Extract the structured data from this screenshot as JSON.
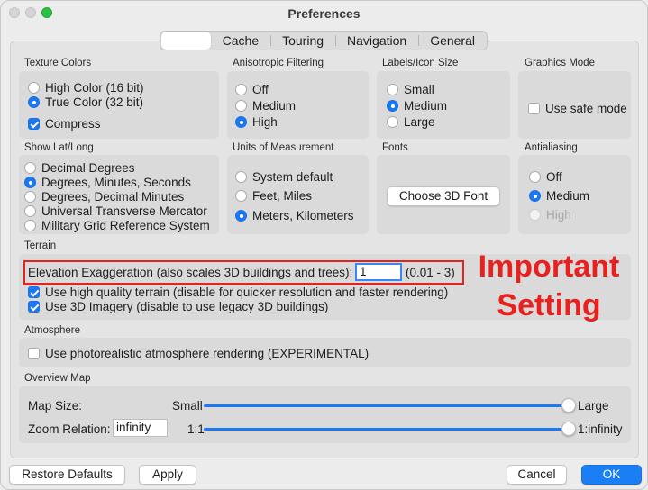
{
  "window": {
    "title": "Preferences"
  },
  "tabs": [
    {
      "label": "",
      "selected": true
    },
    {
      "label": "Cache"
    },
    {
      "label": "Touring"
    },
    {
      "label": "Navigation"
    },
    {
      "label": "General"
    }
  ],
  "texture_colors": {
    "label": "Texture Colors",
    "options": [
      "High Color (16 bit)",
      "True Color (32 bit)"
    ],
    "selected": "True Color (32 bit)",
    "compress_label": "Compress",
    "compress_checked": true
  },
  "anisotropic": {
    "label": "Anisotropic Filtering",
    "options": [
      "Off",
      "Medium",
      "High"
    ],
    "selected": "High"
  },
  "labels_icon_size": {
    "label": "Labels/Icon Size",
    "options": [
      "Small",
      "Medium",
      "Large"
    ],
    "selected": "Medium"
  },
  "graphics_mode": {
    "label": "Graphics Mode",
    "safe_mode_label": "Use safe mode",
    "safe_mode_checked": false
  },
  "show_lat_long": {
    "label": "Show Lat/Long",
    "options": [
      "Decimal Degrees",
      "Degrees, Minutes, Seconds",
      "Degrees, Decimal Minutes",
      "Universal Transverse Mercator",
      "Military Grid Reference System"
    ],
    "selected": "Degrees, Minutes, Seconds"
  },
  "units": {
    "label": "Units of Measurement",
    "options": [
      "System default",
      "Feet, Miles",
      "Meters, Kilometers"
    ],
    "selected": "Meters, Kilometers"
  },
  "fonts": {
    "label": "Fonts",
    "button_label": "Choose 3D Font"
  },
  "antialiasing": {
    "label": "Antialiasing",
    "options": [
      "Off",
      "Medium",
      "High"
    ],
    "selected": "Medium",
    "disabled": "High"
  },
  "terrain": {
    "label": "Terrain",
    "elevation_label": "Elevation Exaggeration (also scales 3D buildings and trees):",
    "elevation_value": "1",
    "elevation_range": "(0.01 - 3)",
    "high_quality_label": "Use high quality terrain (disable for quicker resolution and faster rendering)",
    "high_quality_checked": true,
    "imagery_label": "Use 3D Imagery (disable to use legacy 3D buildings)",
    "imagery_checked": true
  },
  "annotation": {
    "line1": "Important",
    "line2": "Setting",
    "color": "#e8211f"
  },
  "atmosphere": {
    "label": "Atmosphere",
    "photorealistic_label": "Use photorealistic atmosphere rendering (EXPERIMENTAL)",
    "photorealistic_checked": false
  },
  "overview_map": {
    "label": "Overview Map",
    "map_size_label": "Map Size:",
    "map_size_min": "Small",
    "map_size_max": "Large",
    "map_size_level": 1.0,
    "zoom_relation_label": "Zoom Relation:",
    "zoom_relation_value": "infinity",
    "zoom_min": "1:1",
    "zoom_max": "1:infinity",
    "zoom_level": 1.0
  },
  "buttons": {
    "restore_defaults": "Restore Defaults",
    "apply": "Apply",
    "cancel": "Cancel",
    "ok": "OK"
  },
  "colors": {
    "accent": "#1a78f2",
    "highlight": "#e32222"
  }
}
